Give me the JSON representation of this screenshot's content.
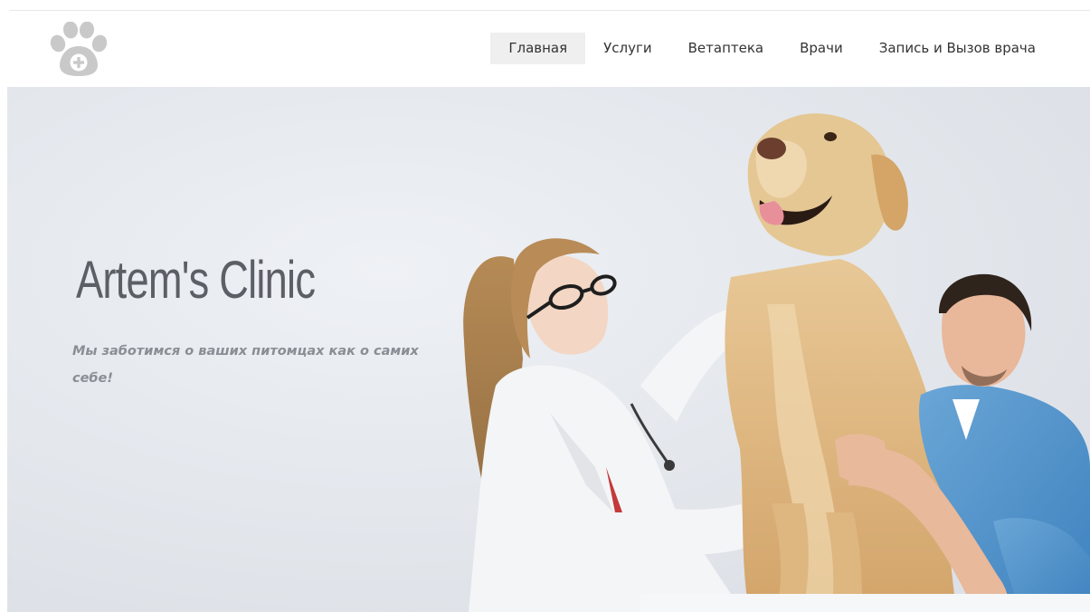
{
  "logo": {
    "icon": "paw-plus-icon",
    "color": "#c9c9c9"
  },
  "nav": {
    "items": [
      {
        "label": "Главная",
        "active": true
      },
      {
        "label": "Услуги",
        "active": false
      },
      {
        "label": "Ветаптека",
        "active": false
      },
      {
        "label": "Врачи",
        "active": false
      },
      {
        "label": "Запись и Вызов врача",
        "active": false
      }
    ]
  },
  "hero": {
    "title": "Artem's Clinic",
    "tagline": "Мы заботимся о ваших питомцах как о самих себе!",
    "image": "vet-doctors-with-dog-illustration"
  },
  "colors": {
    "title": "#5d5f66",
    "tagline": "#8a8d94",
    "nav_active_bg": "#efefef",
    "hero_bg": "#e4e7eb"
  }
}
